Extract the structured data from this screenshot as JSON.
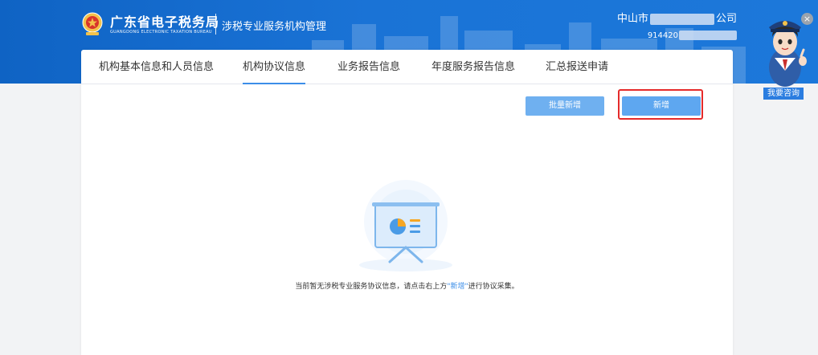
{
  "header": {
    "logo_title": "广东省电子税务局",
    "logo_subtitle": "GUANGDONG ELECTRONIC TAXATION BUREAU",
    "system_title": "涉税专业服务机构管理",
    "company_prefix": "中山市",
    "company_suffix": "公司",
    "tax_id_prefix": "914420"
  },
  "tabs": [
    {
      "label": "机构基本信息和人员信息",
      "active": false
    },
    {
      "label": "机构协议信息",
      "active": true
    },
    {
      "label": "业务报告信息",
      "active": false
    },
    {
      "label": "年度服务报告信息",
      "active": false
    },
    {
      "label": "汇总报送申请",
      "active": false
    }
  ],
  "toolbar": {
    "batch_add_label": "批量新增",
    "add_label": "新增"
  },
  "empty_state": {
    "text_before": "当前暂无涉税专业服务协议信息，请点击右上方",
    "link_text": "\"新增\"",
    "text_after": "进行协议采集。"
  },
  "assistant": {
    "label": "我要咨询",
    "close_glyph": "×"
  },
  "colors": {
    "header_blue": "#1a73d6",
    "button_blue": "#5ea7f0",
    "highlight_red": "#e52b2b",
    "tab_underline": "#3c8ee8"
  }
}
